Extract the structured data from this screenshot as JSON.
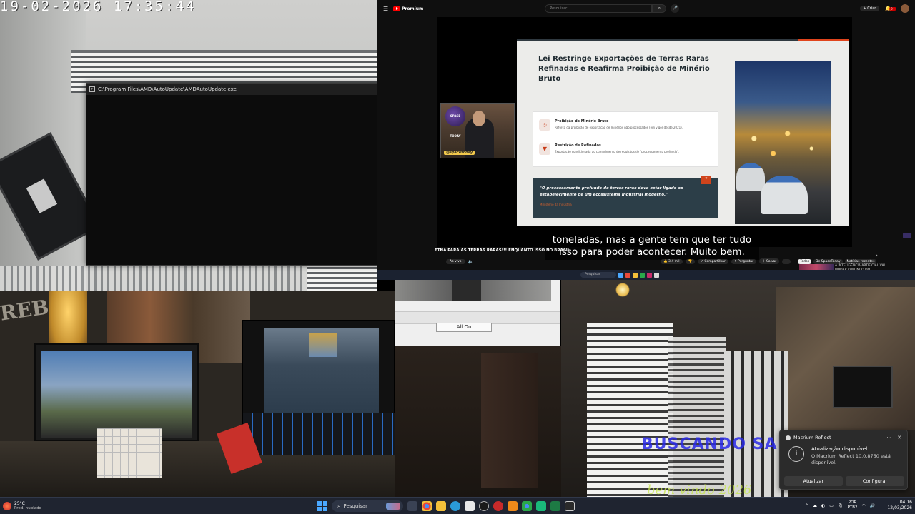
{
  "camera_top_left": {
    "timestamp": "19-02-2026  17:35:44"
  },
  "console_window": {
    "title": "C:\\Program Files\\AMD\\AutoUpdate\\AMDAutoUpdate.exe",
    "minimize": "—",
    "maximize": "☐",
    "close": "✕"
  },
  "youtube": {
    "logo_text": "Premium",
    "search_placeholder": "Pesquisar",
    "create_label": "+ Criar",
    "notif_count": "9+",
    "slide": {
      "title": "Lei Restringe Exportações de Terras Raras Refinadas e Reafirma Proibição de Minério Bruto",
      "item1_title": "Proibição de Minério Bruto",
      "item1_text": "Reforço da proibição de exportação de minérios não processados (em vigor desde 2021).",
      "item2_title": "Restrição de Refinados",
      "item2_text": "Exportação condicionada ao cumprimento de requisitos de \"processamento profundo\".",
      "quote": "\"O processamento profundo de terras raras deve estar ligado ao estabelecimento de um ecossistema industrial moderno.\"",
      "quote_source": "Ministério da Indústria"
    },
    "cam_overlay_handle": "@spacetoday",
    "cam_overlay_logo": "SPACE TODAY",
    "subtitle_line1": "toneladas, mas a gente tem que ter tudo",
    "subtitle_line2": "isso para poder acontecer. Muito bem.",
    "ticker": "ETNÃ PARA AS TERRAS RARAS!!! ENQUANTO ISSO NO BRASIL...",
    "live_label": "Ao vivo",
    "likes": "3,4 mil",
    "share": "Compartilhar",
    "ask": "Perguntar",
    "save": "Salvar",
    "chips": [
      "Todos",
      "De SpaceToday",
      "Notícias recentes"
    ],
    "side_text": "A INTELIGÊNCIA ARTIFICIAL VAI MUDAR O MUNDO DO..."
  },
  "nested_taskbar": {
    "search": "Pesquisar"
  },
  "nested_window": {
    "all_on_label": "All On"
  },
  "camera_bottom_left": {
    "graffiti": "REB"
  },
  "camera_bottom_right": {
    "blue_text": "BUSCANDO  SA",
    "green_text": "bem vindo 2026"
  },
  "toast": {
    "app_name": "Macrium Reflect",
    "more": "···",
    "close": "✕",
    "title": "Atualização disponível",
    "message": "O Macrium Reflect 10.0.8750 está disponível.",
    "btn_update": "Atualizar",
    "btn_configure": "Configurar"
  },
  "taskbar": {
    "temperature": "25°C",
    "condition": "Pred. nublado",
    "search_label": "Pesquisar",
    "lang_top": "POR",
    "lang_bottom": "PTB2",
    "time": "04:16",
    "date": "12/03/2026",
    "app_icon_colors": [
      "#f3c03a",
      "#3a8ad8",
      "#e84a3a",
      "#2aa84a",
      "#c82a6a",
      "#e88a2a",
      "#8a4ad8",
      "#2a6a4a",
      "#1aa0d8",
      "#d8d8d8"
    ]
  }
}
